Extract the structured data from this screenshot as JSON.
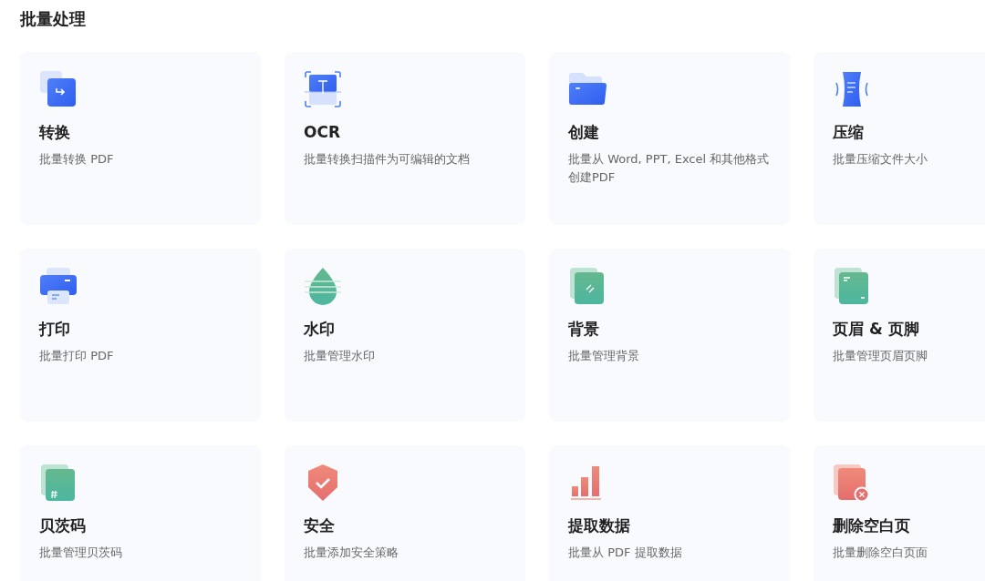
{
  "title": "批量处理",
  "cards": [
    {
      "kind": "convert",
      "title": "转换",
      "description": "批量转换 PDF"
    },
    {
      "kind": "ocr",
      "title": "OCR",
      "description": "批量转换扫描件为可编辑的文档"
    },
    {
      "kind": "create",
      "title": "创建",
      "description": "批量从 Word, PPT, Excel 和其他格式创建PDF"
    },
    {
      "kind": "compress",
      "title": "压缩",
      "description": "批量压缩文件大小"
    },
    {
      "kind": "print",
      "title": "打印",
      "description": "批量打印 PDF"
    },
    {
      "kind": "watermark",
      "title": "水印",
      "description": "批量管理水印"
    },
    {
      "kind": "background",
      "title": "背景",
      "description": "批量管理背景"
    },
    {
      "kind": "header",
      "title": "页眉 & 页脚",
      "description": "批量管理页眉页脚"
    },
    {
      "kind": "bates",
      "title": "贝茨码",
      "description": "批量管理贝茨码"
    },
    {
      "kind": "security",
      "title": "安全",
      "description": "批量添加安全策略"
    },
    {
      "kind": "extract",
      "title": "提取数据",
      "description": "批量从 PDF 提取数据"
    },
    {
      "kind": "blank",
      "title": "删除空白页",
      "description": "批量删除空白页面"
    }
  ]
}
